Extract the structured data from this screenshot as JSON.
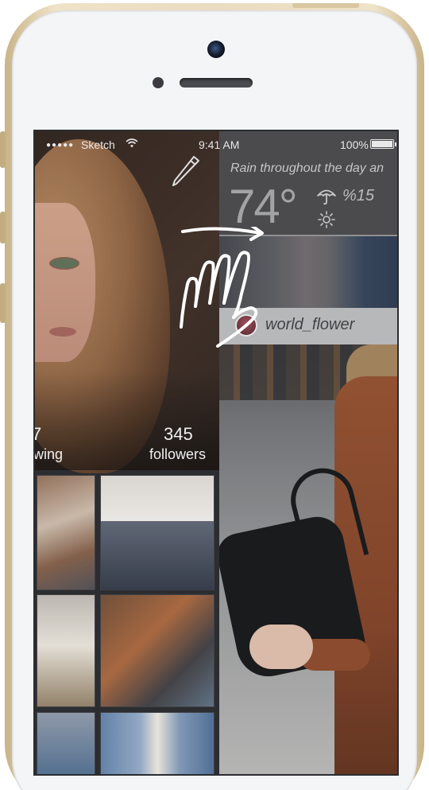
{
  "status_bar": {
    "signal": "●●●●●",
    "carrier": "Sketch",
    "time": "9:41 AM",
    "battery": "100%"
  },
  "profile": {
    "following_count": "7",
    "following_label": "wing",
    "followers_count": "345",
    "followers_label": "followers",
    "edit_icon": "pencil-icon"
  },
  "weather": {
    "forecast": "Rain throughout the day an",
    "temperature": "74°",
    "precipitation": "%15",
    "icons": [
      "umbrella-icon",
      "sun-icon"
    ]
  },
  "feed": {
    "username": "world_flower"
  },
  "gesture": {
    "icon": "swipe-hand-icon",
    "direction": "right"
  },
  "colors": {
    "phone_frame": "#e9dcc0",
    "phone_face": "#f4f5f7",
    "screen_bg": "#232529",
    "weather_bg": "#464648",
    "user_bar_bg": "#bebebf"
  }
}
